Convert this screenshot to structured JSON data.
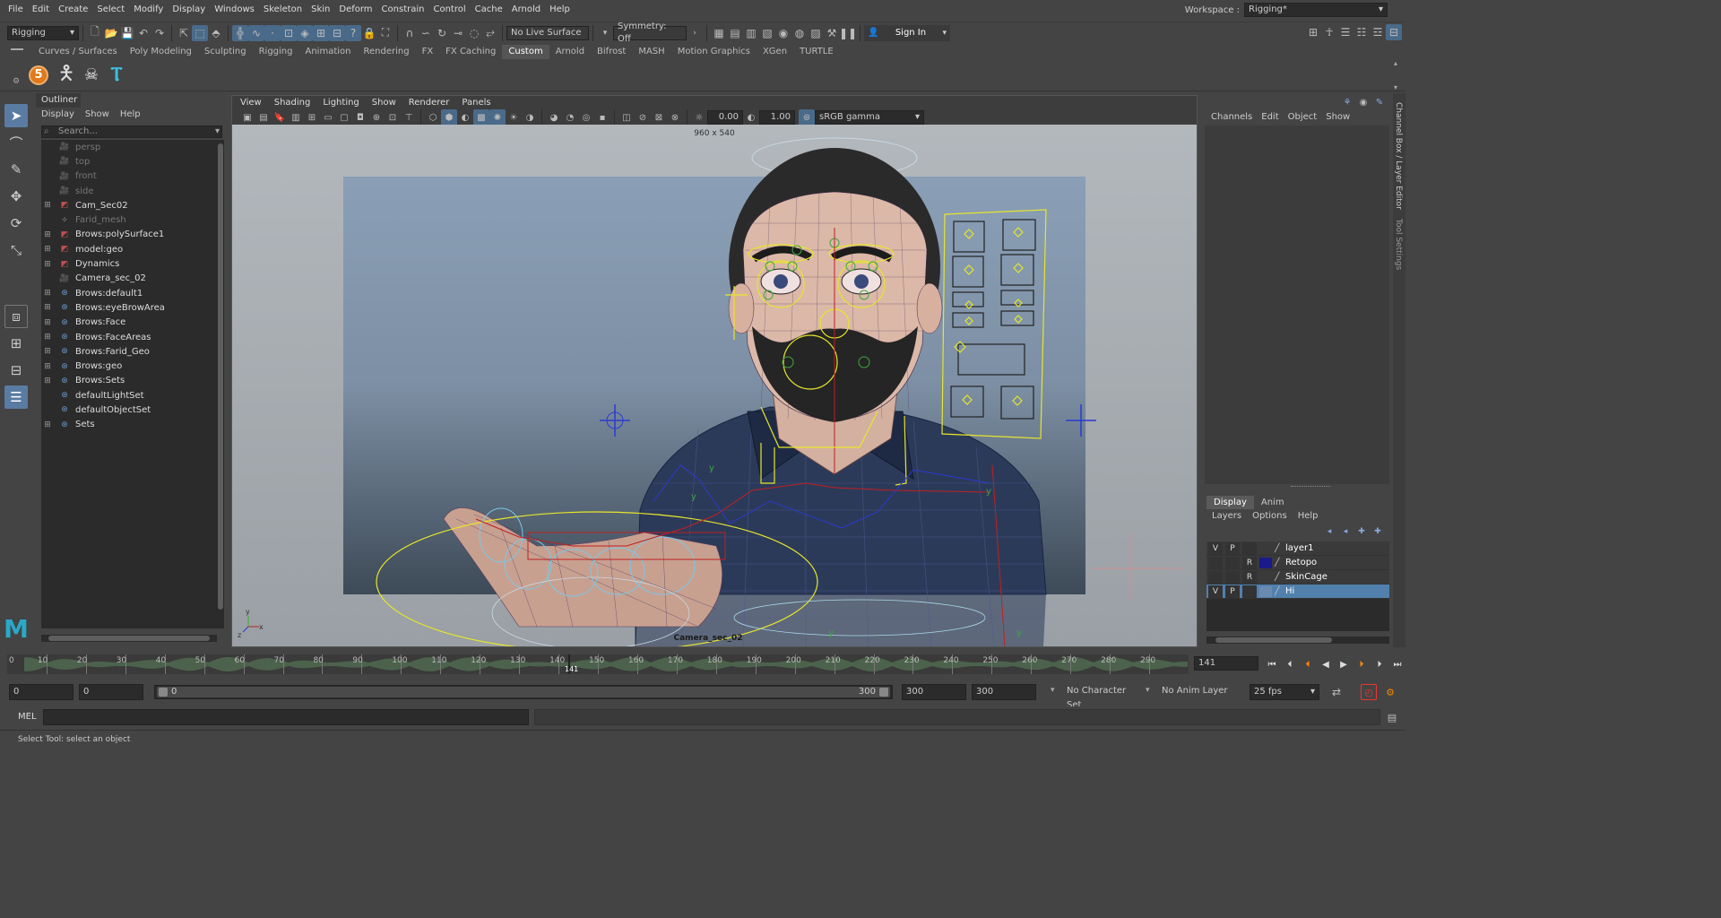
{
  "menubar": {
    "items": [
      "File",
      "Edit",
      "Create",
      "Select",
      "Modify",
      "Display",
      "Windows",
      "Skeleton",
      "Skin",
      "Deform",
      "Constrain",
      "Control",
      "Cache",
      "Arnold",
      "Help"
    ],
    "workspace_label": "Workspace :",
    "workspace_value": "Rigging*"
  },
  "statusline": {
    "mode": "Rigging",
    "live_surface": "No Live Surface",
    "symmetry": "Symmetry: Off",
    "sign_in": "Sign In"
  },
  "shelf": {
    "tabs": [
      "Curves / Surfaces",
      "Poly Modeling",
      "Sculpting",
      "Rigging",
      "Animation",
      "Rendering",
      "FX",
      "FX Caching",
      "Custom",
      "Arnold",
      "Bifrost",
      "MASH",
      "Motion Graphics",
      "XGen",
      "TURTLE"
    ],
    "active_tab": "Custom",
    "badge": "5"
  },
  "outliner": {
    "title": "Outliner",
    "menus": [
      "Display",
      "Show",
      "Help"
    ],
    "search_placeholder": "Search...",
    "items": [
      {
        "label": "persp",
        "icon": "camera-icon",
        "expandable": false,
        "dim": true
      },
      {
        "label": "top",
        "icon": "camera-icon",
        "expandable": false,
        "dim": true
      },
      {
        "label": "front",
        "icon": "camera-icon",
        "expandable": false,
        "dim": true
      },
      {
        "label": "side",
        "icon": "camera-icon",
        "expandable": false,
        "dim": true
      },
      {
        "label": "Cam_Sec02",
        "icon": "mesh-icon",
        "expandable": true,
        "dim": false
      },
      {
        "label": "Farid_mesh",
        "icon": "transform-icon",
        "expandable": false,
        "dim": true
      },
      {
        "label": "Brows:polySurface1",
        "icon": "mesh-icon",
        "expandable": true,
        "dim": false
      },
      {
        "label": "model:geo",
        "icon": "mesh-icon",
        "expandable": true,
        "dim": false
      },
      {
        "label": "Dynamics",
        "icon": "mesh-icon",
        "expandable": true,
        "dim": false
      },
      {
        "label": "Camera_sec_02",
        "icon": "camera-icon",
        "expandable": false,
        "dim": false
      },
      {
        "label": "Brows:default1",
        "icon": "set-icon",
        "expandable": true,
        "dim": false
      },
      {
        "label": "Brows:eyeBrowArea",
        "icon": "set-icon",
        "expandable": true,
        "dim": false
      },
      {
        "label": "Brows:Face",
        "icon": "set-icon",
        "expandable": true,
        "dim": false
      },
      {
        "label": "Brows:FaceAreas",
        "icon": "set-icon",
        "expandable": true,
        "dim": false
      },
      {
        "label": "Brows:Farid_Geo",
        "icon": "set-icon",
        "expandable": true,
        "dim": false
      },
      {
        "label": "Brows:geo",
        "icon": "set-icon",
        "expandable": true,
        "dim": false
      },
      {
        "label": "Brows:Sets",
        "icon": "set-icon",
        "expandable": true,
        "dim": false
      },
      {
        "label": "defaultLightSet",
        "icon": "set-icon",
        "expandable": false,
        "dim": false
      },
      {
        "label": "defaultObjectSet",
        "icon": "set-icon",
        "expandable": false,
        "dim": false
      },
      {
        "label": "Sets",
        "icon": "set-icon",
        "expandable": true,
        "dim": false
      }
    ]
  },
  "viewport": {
    "menus": [
      "View",
      "Shading",
      "Lighting",
      "Show",
      "Renderer",
      "Panels"
    ],
    "exposure": "0.00",
    "gamma": "1.00",
    "color_space": "sRGB gamma",
    "resolution": "960 x 540",
    "camera_name": "Camera_sec_02",
    "axis_labels": {
      "x": "x",
      "y": "y",
      "z": "z"
    }
  },
  "channelbox": {
    "menus": [
      "Channels",
      "Edit",
      "Object",
      "Show"
    ]
  },
  "layer_editor": {
    "tabs": [
      "Display",
      "Anim"
    ],
    "active_tab": "Display",
    "menus": [
      "Layers",
      "Options",
      "Help"
    ],
    "layers": [
      {
        "v": "V",
        "p": "P",
        "r": "",
        "name": "layer1",
        "color": "#3a3a3a",
        "selected": false
      },
      {
        "v": "",
        "p": "",
        "r": "R",
        "name": "Retopo",
        "color": "#1a1a8a",
        "selected": false
      },
      {
        "v": "",
        "p": "",
        "r": "R",
        "name": "SkinCage",
        "color": "#3a3a3a",
        "selected": false
      },
      {
        "v": "V",
        "p": "P",
        "r": "",
        "name": "Hi",
        "color": "#6a8ab0",
        "selected": true
      }
    ],
    "side_tabs": [
      "Channel Box / Layer Editor",
      "Tool Settings"
    ]
  },
  "timeline": {
    "ticks": [
      "10",
      "20",
      "30",
      "40",
      "50",
      "60",
      "70",
      "80",
      "90",
      "100",
      "110",
      "120",
      "130",
      "140",
      "150",
      "160",
      "170",
      "180",
      "190",
      "200",
      "210",
      "220",
      "230",
      "240",
      "250",
      "260",
      "270",
      "280",
      "290"
    ],
    "first_tick": "0",
    "current_marker": "141",
    "current_frame": "141"
  },
  "range": {
    "start": "0",
    "playback_start": "0",
    "slider_start": "0",
    "slider_end": "300",
    "playback_end": "300",
    "end": "300",
    "character_set": "No Character Set",
    "anim_layer": "No Anim Layer",
    "fps": "25 fps"
  },
  "commandline": {
    "label": "MEL"
  },
  "helpline": {
    "text": "Select Tool: select an object"
  },
  "colors": {
    "accent": "#5a7ca3",
    "timeline_waveform": "#5e8a5e",
    "control_yellow": "#e6e62a"
  }
}
